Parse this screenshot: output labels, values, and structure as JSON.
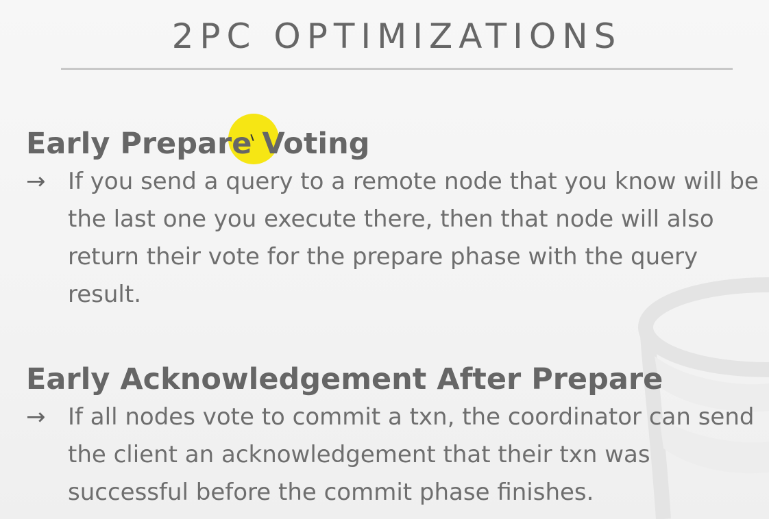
{
  "slide": {
    "title": "2PC OPTIMIZATIONS",
    "sections": [
      {
        "heading": "Early Prepare Voting",
        "arrow": "→",
        "text": "If you send a query to a remote node that you know will be the last one you execute there, then that node will also return their vote for the prepare phase with the query result."
      },
      {
        "heading": "Early Acknowledgement After Prepare",
        "arrow": "→",
        "text": "If all nodes vote to commit a txn, the coordinator can send the client an acknowledgement that their txn was successful before the commit phase finishes."
      }
    ]
  },
  "colors": {
    "text": "#6b6b6b",
    "rule": "#c8c8c8",
    "cursor_highlight": "#f5e400",
    "background": "#f4f4f4"
  },
  "icons": {
    "watermark": "database-cylinder-icon",
    "cursor": "mouse-pointer-icon"
  }
}
